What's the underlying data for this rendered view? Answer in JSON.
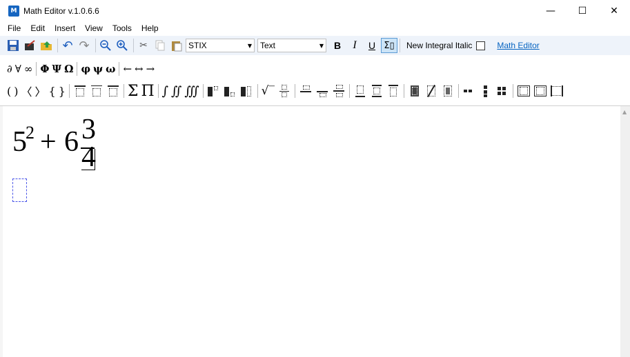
{
  "window": {
    "title": "Math Editor v.1.0.6.6",
    "icon_letter": "M",
    "controls": [
      "minimize-icon",
      "maximize-icon",
      "close-icon"
    ]
  },
  "menu": {
    "items": [
      "File",
      "Edit",
      "Insert",
      "View",
      "Tools",
      "Help"
    ]
  },
  "toolbar": {
    "font_combo": "STIX",
    "style_combo": "Text",
    "bold_label": "B",
    "italic_label": "I",
    "underline_label": "U",
    "integral_italic_label": "New Integral Italic",
    "math_editor_link": "Math Editor"
  },
  "symbols": {
    "row1": [
      "∂",
      "∀",
      "∞",
      "Φ",
      "Ψ",
      "Ω",
      "φ",
      "ψ",
      "ω",
      "←",
      "↔",
      "→"
    ],
    "row2_brackets": [
      "(",
      ")",
      "〈",
      "〉",
      "{",
      "}"
    ],
    "big_operators": [
      "Σ",
      "Π"
    ],
    "integrals": [
      "∫",
      "∬",
      "∭"
    ],
    "sqrt": "√‾"
  },
  "equation": {
    "base": "5",
    "exponent": "2",
    "operator": "+",
    "whole": "6",
    "numerator": "3",
    "denominator": "4"
  }
}
